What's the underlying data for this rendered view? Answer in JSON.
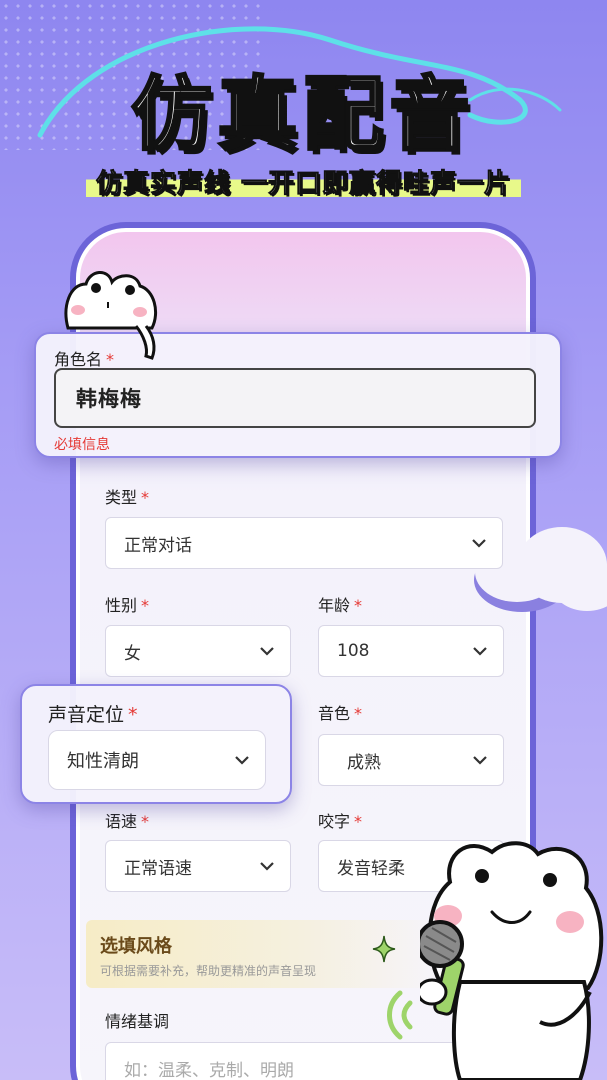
{
  "header": {
    "title": "仿真配音",
    "subtitle": "仿真实声线 一开口即赢得哇声一片"
  },
  "role_card": {
    "label": "角色名",
    "required_mark": "*",
    "value": "韩梅梅",
    "hint": "必填信息"
  },
  "form": {
    "type": {
      "label": "类型",
      "required_mark": "*",
      "value": "正常对话"
    },
    "gender": {
      "label": "性别",
      "required_mark": "*",
      "value": "女"
    },
    "age": {
      "label": "年龄",
      "required_mark": "*",
      "value": "108"
    },
    "voice_position": {
      "label": "声音定位",
      "required_mark": "*",
      "value": "知性清朗"
    },
    "timbre": {
      "label": "音色",
      "required_mark": "*",
      "value": "成熟"
    },
    "speed": {
      "label": "语速",
      "required_mark": "*",
      "value": "正常语速"
    },
    "articulation": {
      "label": "咬字",
      "required_mark": "*",
      "value": "发音轻柔"
    },
    "optional_style": {
      "title": "选填风格",
      "description": "可根据需要补充，帮助更精准的声音呈现"
    },
    "mood": {
      "label": "情绪基调",
      "placeholder": "如：温柔、克制、明朗"
    }
  },
  "colors": {
    "background": "#a59cf5",
    "phone_frame": "#6c64d8",
    "required": "#e53935",
    "highlight": "#e8f98a",
    "mic_green": "#9ed46a"
  }
}
